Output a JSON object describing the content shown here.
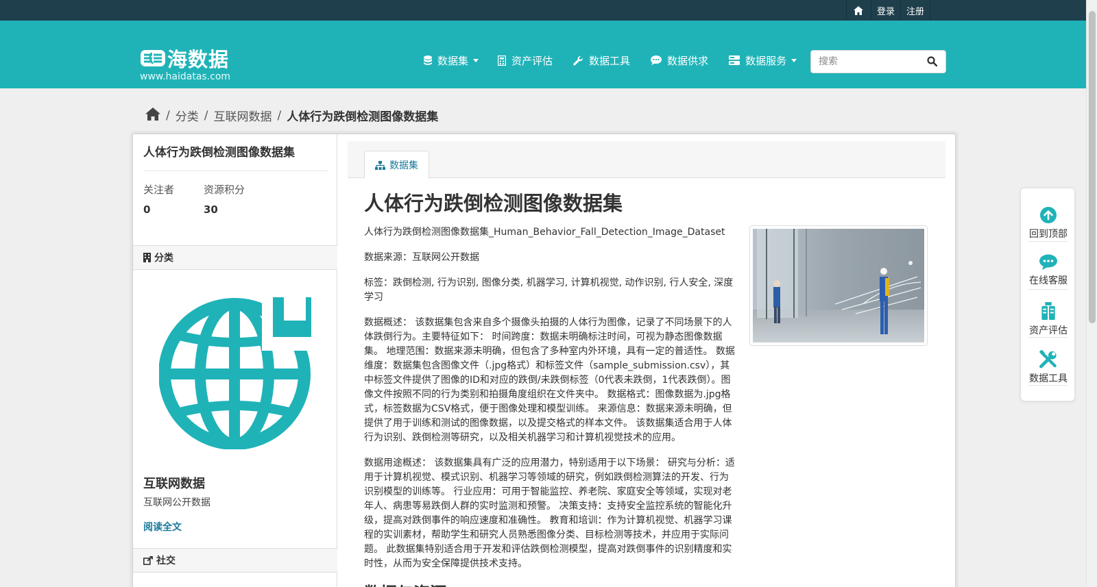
{
  "topbar": {
    "login": "登录",
    "register": "注册"
  },
  "logo": {
    "text": "海数据",
    "url": "www.haidatas.com"
  },
  "nav": [
    {
      "label": "数据集",
      "icon": "database-icon",
      "dropdown": true
    },
    {
      "label": "资产评估",
      "icon": "calculator-icon",
      "dropdown": false
    },
    {
      "label": "数据工具",
      "icon": "wrench-icon",
      "dropdown": false
    },
    {
      "label": "数据供求",
      "icon": "comment-icon",
      "dropdown": false
    },
    {
      "label": "数据服务",
      "icon": "server-icon",
      "dropdown": true
    }
  ],
  "search": {
    "placeholder": "搜索"
  },
  "breadcrumb": {
    "category": "分类",
    "org": "互联网数据",
    "current": "人体行为跌倒检测图像数据集"
  },
  "sidebar": {
    "title": "人体行为跌倒检测图像数据集",
    "followers_label": "关注者",
    "followers": "0",
    "points_label": "资源积分",
    "points": "30",
    "category_heading": "分类",
    "org_name": "互联网数据",
    "org_desc": "互联网公开数据",
    "read_more": "阅读全文",
    "social_heading": "社交"
  },
  "tab": {
    "label": "数据集"
  },
  "dataset": {
    "title": "人体行为跌倒检测图像数据集",
    "paragraphs": [
      "人体行为跌倒检测图像数据集_Human_Behavior_Fall_Detection_Image_Dataset",
      "数据来源：互联网公开数据",
      "标签：跌倒检测, 行为识别, 图像分类, 机器学习, 计算机视觉, 动作识别, 行人安全, 深度学习",
      "数据概述： 该数据集包含来自多个摄像头拍摄的人体行为图像，记录了不同场景下的人体跌倒行为。主要特征如下： 时间跨度：数据未明确标注时间，可视为静态图像数据集。 地理范围：数据来源未明确，但包含了多种室内外环境，具有一定的普适性。 数据维度：数据集包含图像文件（.jpg格式）和标签文件（sample_submission.csv），其中标签文件提供了图像的ID和对应的跌倒/未跌倒标签（0代表未跌倒，1代表跌倒）。图像文件按照不同的行为类别和拍摄角度组织在文件夹中。 数据格式：图像数据为.jpg格式，标签数据为CSV格式，便于图像处理和模型训练。 来源信息：数据来源未明确，但提供了用于训练和测试的图像数据，以及提交格式的样本文件。 该数据集适合用于人体行为识别、跌倒检测等研究，以及相关机器学习和计算机视觉技术的应用。",
      "数据用途概述： 该数据集具有广泛的应用潜力，特别适用于以下场景： 研究与分析：适用于计算机视觉、模式识别、机器学习等领域的研究，例如跌倒检测算法的开发、行为识别模型的训练等。 行业应用：可用于智能监控、养老院、家庭安全等领域，实现对老年人、病患等易跌倒人群的实时监测和预警。 决策支持：支持安全监控系统的智能化升级，提高对跌倒事件的响应速度和准确性。 教育和培训：作为计算机视觉、机器学习课程的实训素材，帮助学生和研究人员熟悉图像分类、目标检测等技术，并应用于实际问题。 此数据集特别适合用于开发和评估跌倒检测模型，提高对跌倒事件的识别精度和实时性，从而为安全保障提供技术支持。"
    ],
    "next_heading": "数据与资源"
  },
  "floatbar": [
    {
      "label": "回到顶部",
      "icon": "arrow-up-circle-icon"
    },
    {
      "label": "在线客服",
      "icon": "chat-bubble-icon"
    },
    {
      "label": "资产评估",
      "icon": "clipboard-icon"
    },
    {
      "label": "数据工具",
      "icon": "tools-icon"
    }
  ],
  "colors": {
    "topbar": "#1f3f4d",
    "brand": "#1fb3b8",
    "link": "#1a7a9c"
  }
}
